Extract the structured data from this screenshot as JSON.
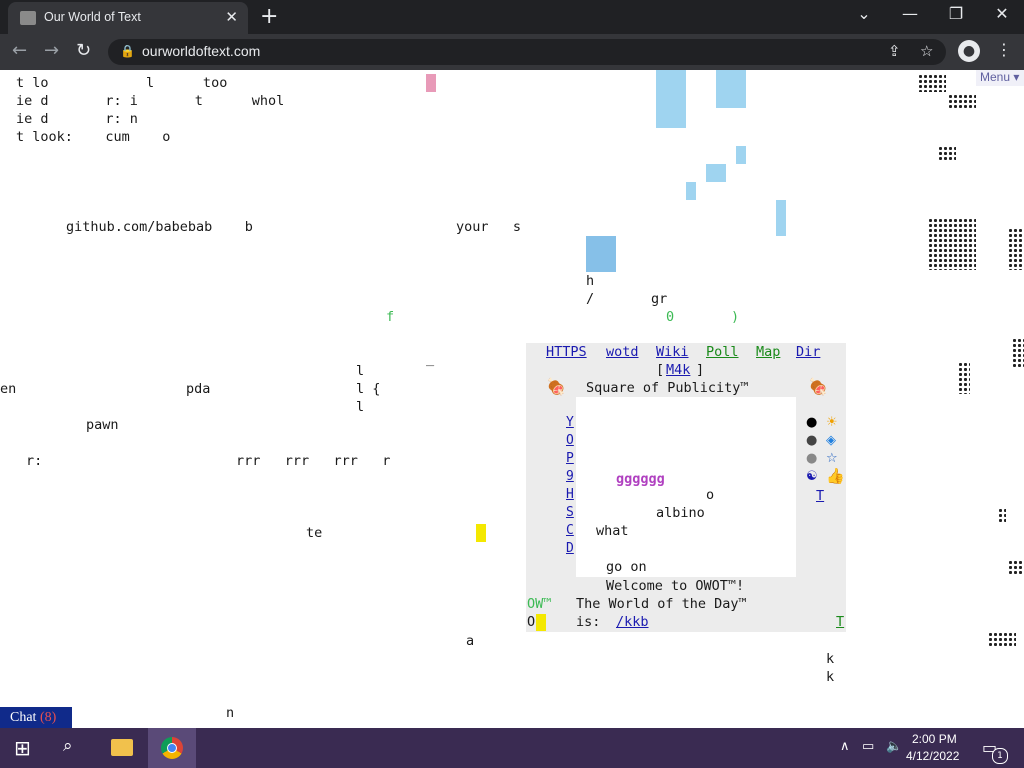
{
  "browser": {
    "tab_title": "Our World of Text",
    "tab_close": "✕",
    "new_tab": "+",
    "url": "ourworldoftext.com",
    "window_controls": [
      "⌄",
      "—",
      "❐",
      "✕"
    ]
  },
  "page": {
    "menu_label": "Menu ▾",
    "text_lines": [
      {
        "text": "t lo            l      too"
      },
      {
        "text": "ie d       r: i       t      whol"
      },
      {
        "text": "ie d       r: n"
      },
      {
        "text": "t look:    cum    o"
      },
      {
        "text": "github.com/babebab    b"
      },
      {
        "text": "your   s"
      },
      {
        "text": "h"
      },
      {
        "text": "/       gr"
      },
      {
        "text": "f"
      },
      {
        "text": "0       )"
      },
      {
        "text": "_"
      },
      {
        "text": "l"
      },
      {
        "text": "en"
      },
      {
        "text": "pda"
      },
      {
        "text": "l {"
      },
      {
        "text": "l"
      },
      {
        "text": "pawn"
      },
      {
        "text": "r:"
      },
      {
        "text": "rrr   rrr   rrr   r"
      },
      {
        "text": "te"
      },
      {
        "text": "a"
      },
      {
        "text": "k"
      },
      {
        "text": "k"
      },
      {
        "text": "n"
      }
    ],
    "square": {
      "links": [
        "HTTPS",
        "wotd",
        "Wiki",
        "Poll",
        "Map",
        "Dir"
      ],
      "m4k_label": "M4k",
      "title": "Square of Publicity™",
      "left_column": [
        "Y",
        "O",
        "P",
        "9",
        "H",
        "S",
        "C",
        "D"
      ],
      "inner_lines": [
        "gggggg",
        "o",
        "albino",
        "what",
        "go on"
      ],
      "welcome": "Welcome to OWOT™!",
      "wotd_line": "The World of the Day™",
      "wotd_is": "is:",
      "wotd_link": "/kkb",
      "ow_label": "OW™",
      "o_label": "O",
      "right_t": "T",
      "side_t": "T"
    },
    "chat": {
      "label": "Chat",
      "count": "(8)"
    }
  },
  "taskbar": {
    "time": "2:00 PM",
    "date": "4/12/2022",
    "notifications": "1"
  },
  "colors": {
    "chrome_dark": "#202124",
    "chrome_toolbar": "#35363a",
    "taskbar": "#3a2b52",
    "link_blue": "#1a1ab0",
    "link_green": "#1a8a1a",
    "chat_bg": "#102a8a"
  }
}
